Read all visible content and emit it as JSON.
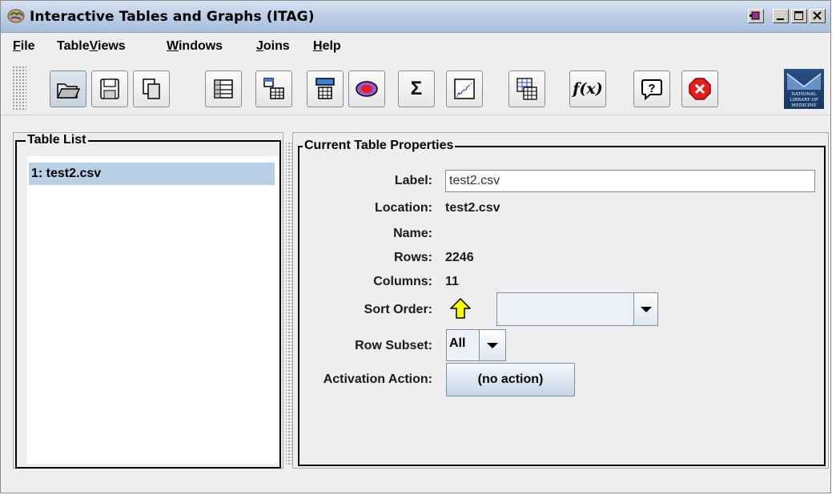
{
  "window": {
    "title": "Interactive Tables and Graphs (ITAG)"
  },
  "menubar": {
    "items": [
      {
        "label": "File",
        "mnemonic": "F",
        "rest": "ile"
      },
      {
        "label": "TableViews",
        "pre": "Table",
        "mnemonic": "V",
        "rest": "iews"
      },
      {
        "label": "Windows",
        "mnemonic": "W",
        "rest": "indows"
      },
      {
        "label": "Joins",
        "mnemonic": "J",
        "rest": "oins"
      },
      {
        "label": "Help",
        "mnemonic": "H",
        "rest": "elp"
      }
    ]
  },
  "toolbar": {
    "icons": [
      "open-folder-icon",
      "save-icon",
      "copy-icon",
      "table-icon",
      "subset-table-icon",
      "column-table-icon",
      "ellipse-icon",
      "sigma-icon",
      "plot-icon",
      "join-table-icon",
      "function-icon",
      "help-icon",
      "stop-icon",
      "nlm-logo"
    ],
    "sigma_glyph": "Σ",
    "function_glyph": "f(x)",
    "help_glyph": "?",
    "logo_text": "NATIONAL LIBRARY OF MEDICINE"
  },
  "table_list": {
    "title": "Table List",
    "items": [
      {
        "label": "1: test2.csv",
        "selected": true
      }
    ]
  },
  "properties": {
    "title": "Current Table Properties",
    "label_caption": "Label:",
    "label_value": "test2.csv",
    "location_caption": "Location:",
    "location_value": "test2.csv",
    "name_caption": "Name:",
    "name_value": "",
    "rows_caption": "Rows:",
    "rows_value": "2246",
    "columns_caption": "Columns:",
    "columns_value": "11",
    "sort_caption": "Sort Order:",
    "sort_value": "",
    "subset_caption": "Row Subset:",
    "subset_value": "All",
    "activation_caption": "Activation Action:",
    "activation_value": "(no action)"
  },
  "colors": {
    "selection": "#b8cfe5",
    "titlebar": "#bfcfe6",
    "sort_arrow": "#ffff00"
  }
}
